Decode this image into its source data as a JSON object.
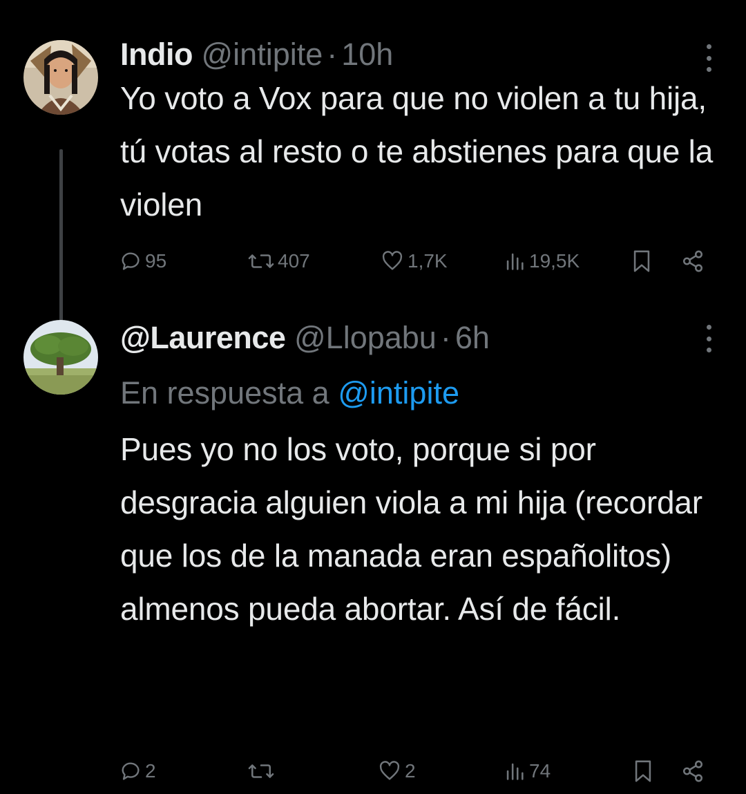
{
  "tweets": [
    {
      "name": "Indio",
      "handle": "@intipite",
      "separator": "·",
      "time": "10h",
      "text": "Yo voto a Vox para que no violen a tu hija, tú votas al resto o te abstienes para que la violen",
      "replies": "95",
      "retweets": "407",
      "likes": "1,7K",
      "views": "19,5K"
    },
    {
      "name": "@Laurence",
      "handle": "@Llopabu",
      "separator": "·",
      "time": "6h",
      "reply_prefix": "En respuesta a",
      "reply_mention": "@intipite",
      "text": "Pues yo no los voto, porque si por desgracia alguien viola a mi hija (recordar que los de la manada eran españolitos) almenos pueda abortar. Así de fácil.",
      "replies": "2",
      "retweets": "",
      "likes": "2",
      "views": "74"
    }
  ],
  "icons": {
    "reply": "speech-bubble-icon",
    "retweet": "retweet-arrows-icon",
    "like": "heart-icon",
    "views": "bar-chart-icon",
    "bookmark": "bookmark-icon",
    "share": "share-nodes-icon",
    "more": "vertical-dots-icon"
  },
  "colors": {
    "background": "#000000",
    "text": "#e7e9ea",
    "muted": "#71767b",
    "link": "#1d9bf0"
  }
}
